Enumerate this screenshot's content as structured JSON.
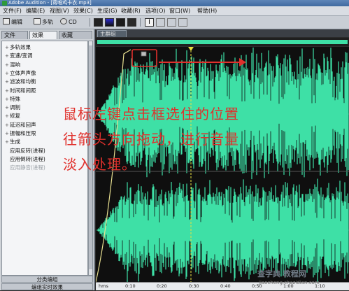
{
  "window": {
    "title": "Adobe Audition - [蒋唯鸡卡衣.mp3]"
  },
  "menu": [
    "文件(F)",
    "编辑(E)",
    "视图(V)",
    "效果(C)",
    "生成(G)",
    "收藏(R)",
    "选项(O)",
    "窗口(W)",
    "帮助(H)"
  ],
  "toolbar": {
    "edit_label": "编辑",
    "multitrack_label": "多轨",
    "cd_label": "CD"
  },
  "left_panel": {
    "tabs": [
      "文件",
      "效果",
      "收藏"
    ],
    "tree": [
      {
        "label": "多轨效果",
        "expandable": true
      },
      {
        "label": "变速/变调",
        "expandable": true
      },
      {
        "label": "混响",
        "expandable": true
      },
      {
        "label": "立体声声像",
        "expandable": true
      },
      {
        "label": "滤波和均衡",
        "expandable": true
      },
      {
        "label": "时间和间距",
        "expandable": true
      },
      {
        "label": "特殊",
        "expandable": true
      },
      {
        "label": "调制",
        "expandable": true
      },
      {
        "label": "修复",
        "expandable": true
      },
      {
        "label": "延迟和回声",
        "expandable": true
      },
      {
        "label": "振幅和压限",
        "expandable": true
      },
      {
        "label": "生成",
        "expandable": true
      },
      {
        "label": "应用反转(进程)",
        "expandable": false
      },
      {
        "label": "应用倒转(进程)",
        "expandable": false
      },
      {
        "label": "应用静音(进程)",
        "expandable": false,
        "dim": true
      }
    ],
    "bottom_tabs": [
      "分类编组",
      "编组实时效果"
    ]
  },
  "editor": {
    "tab_label": "主群组",
    "annotation": "鼠标左键点击框选住的位置往箭头方向拖动，进行音量淡入处理。",
    "annotation_lines": [
      "鼠标左键点击框选住的位置",
      "往箭头方向拖动，进行音量",
      "淡入处理。"
    ],
    "waveform_color": "#3ee0a6",
    "annotation_color": "#e0302c"
  },
  "timeline": {
    "ticks": [
      "hms",
      "0:10",
      "0:20",
      "0:30",
      "0:40",
      "0:50",
      "1:00",
      "1:10"
    ]
  },
  "watermark": {
    "brand": "查字典 教程网",
    "url": "jiaocheng.chazidian.com"
  }
}
